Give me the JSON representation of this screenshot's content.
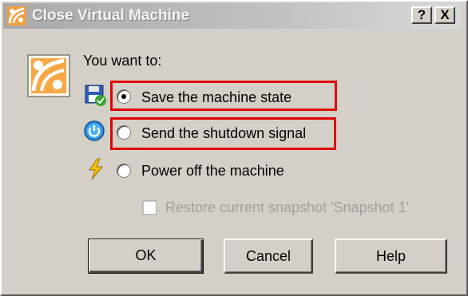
{
  "window": {
    "title": "Close Virtual Machine",
    "help_button": "?",
    "close_button": "X"
  },
  "prompt": "You want to:",
  "options": [
    {
      "label": "Save the machine state",
      "icon": "save-state-icon",
      "selected": true,
      "highlighted": true
    },
    {
      "label": "Send the shutdown signal",
      "icon": "power-button-icon",
      "selected": false,
      "highlighted": true
    },
    {
      "label": "Power off the machine",
      "icon": "lightning-icon",
      "selected": false,
      "highlighted": false
    }
  ],
  "restore_snapshot": {
    "label": "Restore current snapshot 'Snapshot 1'",
    "checked": false,
    "enabled": false
  },
  "buttons": {
    "ok": "OK",
    "cancel": "Cancel",
    "help": "Help"
  },
  "colors": {
    "dialog_bg": "#d4d0c8",
    "highlight": "#e00000",
    "disabled_text": "#a0a0a0"
  }
}
